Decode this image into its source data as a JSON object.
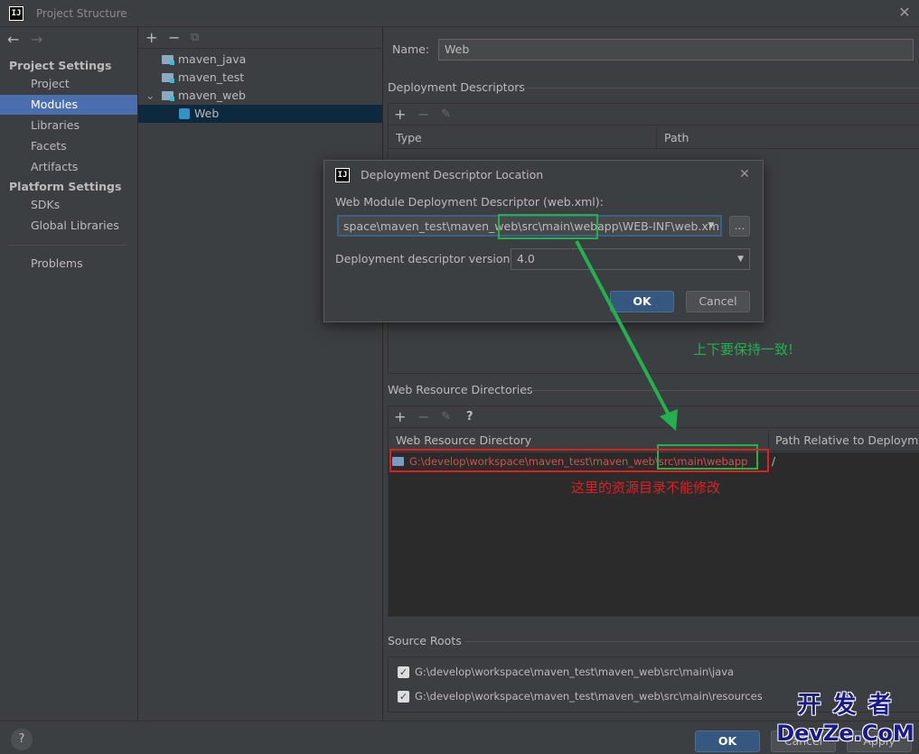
{
  "window": {
    "title": "Project Structure",
    "logo": "IJ",
    "close_glyph": "✕"
  },
  "sidebar": {
    "back": "←",
    "forward": "→",
    "project_settings": "Project Settings",
    "project_items": [
      "Project",
      "Modules",
      "Libraries",
      "Facets",
      "Artifacts"
    ],
    "platform_settings": "Platform Settings",
    "platform_items": [
      "SDKs",
      "Global Libraries"
    ],
    "problems": "Problems",
    "selected": "Modules"
  },
  "tree": {
    "tools": {
      "add": "+",
      "remove": "−",
      "copy": "⧉"
    },
    "nodes": [
      "maven_java",
      "maven_test",
      "maven_web",
      "Web"
    ],
    "selected": "Web"
  },
  "facet": {
    "name_label": "Name:",
    "name_value": "Web",
    "deployment_descriptors": {
      "title": "Deployment Descriptors",
      "tools": {
        "add": "+",
        "remove": "−",
        "edit": "✎"
      },
      "columns": [
        "Type",
        "Path"
      ]
    },
    "web_resource_dirs": {
      "title": "Web Resource Directories",
      "tools": {
        "add": "+",
        "remove": "−",
        "edit": "✎",
        "help": "?"
      },
      "columns": [
        "Web Resource Directory",
        "Path Relative to Deployme..."
      ],
      "rows": [
        {
          "dir": "G:\\develop\\workspace\\maven_test\\maven_web\\src\\main\\webapp",
          "path": "/"
        }
      ]
    },
    "source_roots": {
      "title": "Source Roots",
      "items": [
        "G:\\develop\\workspace\\maven_test\\maven_web\\src\\main\\java",
        "G:\\develop\\workspace\\maven_test\\maven_web\\src\\main\\resources"
      ]
    }
  },
  "dialog": {
    "title": "Deployment Descriptor Location",
    "logo": "IJ",
    "field_label": "Web Module Deployment Descriptor (web.xml):",
    "field_value": "space\\maven_test\\maven_web\\src\\main\\webapp\\WEB-INF\\web.xml",
    "browse_label": "...",
    "version_label": "Deployment descriptor version",
    "version_value": "4.0",
    "ok": "OK",
    "cancel": "Cancel"
  },
  "annotations": {
    "keep_consistent": "上下要保持一致!",
    "cannot_modify": "这里的资源目录不能修改"
  },
  "bottom": {
    "help": "?",
    "ok": "OK",
    "cancel": "Cancel",
    "apply": "Apply"
  },
  "watermark": {
    "line1": "开 发 者",
    "line2": "DevZe.CoM"
  },
  "colors": {
    "selection": "#4b6eaf",
    "annotation_green": "#22b14c",
    "annotation_red": "#e02020",
    "primary_button": "#365880"
  }
}
